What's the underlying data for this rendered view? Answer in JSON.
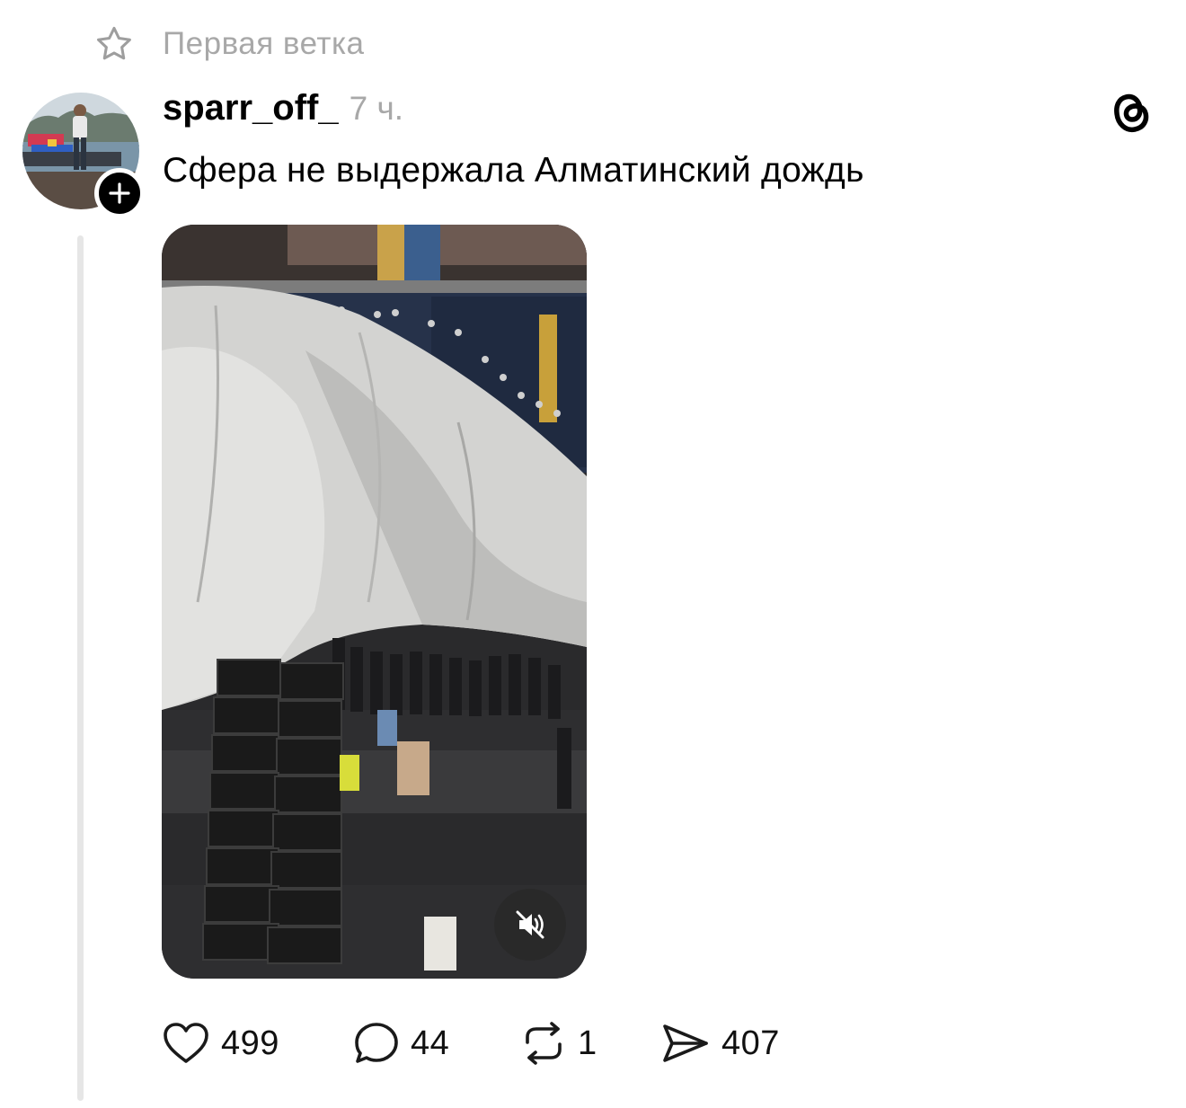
{
  "context": {
    "icon": "star-outline-icon",
    "label": "Первая ветка"
  },
  "post": {
    "username": "sparr_off_",
    "time": "7 ч.",
    "text": "Сфера не выдержала Алматинский дождь",
    "media": {
      "type": "video",
      "muted": true
    }
  },
  "actions": {
    "likes": "499",
    "replies": "44",
    "reposts": "1",
    "shares": "407"
  },
  "colors": {
    "muted_text": "#a8a8a8",
    "thread_line": "#e6e6e6",
    "text": "#000000"
  }
}
